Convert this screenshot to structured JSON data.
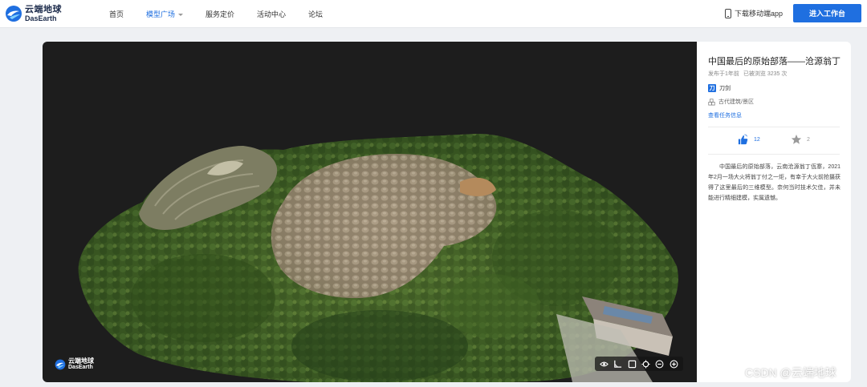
{
  "brand": {
    "name_cn": "云端地球",
    "name_en": "DasEarth"
  },
  "nav": {
    "items": [
      {
        "label": "首页",
        "active": false,
        "has_caret": false
      },
      {
        "label": "模型广场",
        "active": true,
        "has_caret": true
      },
      {
        "label": "服务定价",
        "active": false,
        "has_caret": false
      },
      {
        "label": "活动中心",
        "active": false,
        "has_caret": false
      },
      {
        "label": "论坛",
        "active": false,
        "has_caret": false
      }
    ],
    "app_download": "下载移动端app",
    "cta": "进入工作台"
  },
  "model": {
    "title": "中国最后的原始部落——沧源翁丁",
    "published": "发布于1年前",
    "views": "已被浏览 3235 次",
    "author_badge": "刀",
    "author": "刀剑",
    "category": "古代建筑/景区",
    "task_link": "查看任务信息",
    "likes": "12",
    "stars": "2",
    "description": "中国最后的原始部落，云南沧源翁丁佤寨，2021年2月一场大火将翁丁付之一炬，有幸于大火前抢摄获得了这里最后的三维模型。奈何当时技术欠佳，并未能进行精细建模，实属遗憾。"
  },
  "viewer": {
    "watermark_cn": "云端地球",
    "watermark_en": "DasEarth",
    "tools": [
      "eye-icon",
      "measure-angle-icon",
      "frame-icon",
      "locate-icon",
      "zoom-out-icon",
      "zoom-in-icon"
    ]
  },
  "colors": {
    "accent": "#1f6fe0",
    "viewer_bg": "#1d1d1d",
    "page_bg": "#eef0f3"
  },
  "credit": "CSDN @云端地球"
}
